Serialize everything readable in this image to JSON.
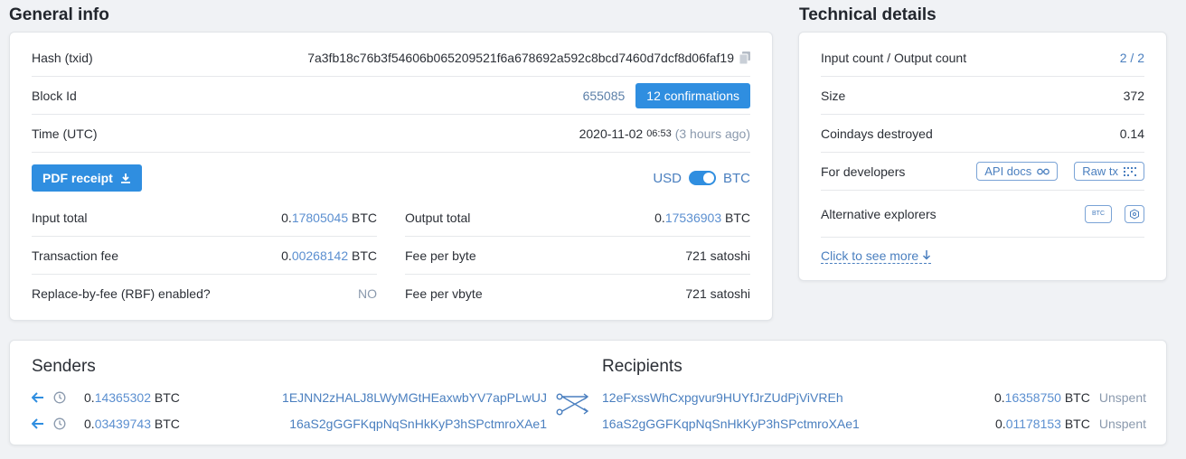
{
  "general": {
    "title": "General info",
    "hash_label": "Hash (txid)",
    "hash_value": "7a3fb18c76b3f54606b065209521f6a678692a592c8bcd7460d7dcf8d06faf19",
    "block_label": "Block Id",
    "block_value": "655085",
    "confirmations": "12 confirmations",
    "time_label": "Time (UTC)",
    "time_date": "2020-11-02",
    "time_clock": "06:53",
    "time_ago": "(3 hours ago)",
    "pdf_label": "PDF receipt",
    "toggle_left": "USD",
    "toggle_right": "BTC",
    "input_total_label": "Input total",
    "input_total_int": "0.",
    "input_total_frac": "17805045",
    "output_total_label": "Output total",
    "output_total_int": "0.",
    "output_total_frac": "17536903",
    "fee_label": "Transaction fee",
    "fee_int": "0.",
    "fee_frac": "00268142",
    "fee_byte_label": "Fee per byte",
    "fee_byte_value": "721 satoshi",
    "rbf_label": "Replace-by-fee (RBF) enabled?",
    "rbf_value": "NO",
    "fee_vbyte_label": "Fee per vbyte",
    "fee_vbyte_value": "721 satoshi",
    "unit": "BTC"
  },
  "technical": {
    "title": "Technical details",
    "io_label": "Input count / Output count",
    "io_value": "2 / 2",
    "size_label": "Size",
    "size_value": "372",
    "coindays_label": "Coindays destroyed",
    "coindays_value": "0.14",
    "dev_label": "For developers",
    "api_docs": "API docs",
    "raw_tx": "Raw tx",
    "alt_label": "Alternative explorers",
    "alt_badge": "BTC",
    "more": "Click to see more"
  },
  "flow": {
    "senders_title": "Senders",
    "recipients_title": "Recipients",
    "senders": [
      {
        "int": "0.",
        "frac": "14365302",
        "unit": "BTC",
        "address": "1EJNN2zHALJ8LWyMGtHEaxwbYV7apPLwUJ"
      },
      {
        "int": "0.",
        "frac": "03439743",
        "unit": "BTC",
        "address": "16aS2gGGFKqpNqSnHkKyP3hSPctmroXAe1"
      }
    ],
    "recipients": [
      {
        "address": "12eFxssWhCxpgvur9HUYfJrZUdPjViVREh",
        "int": "0.",
        "frac": "16358750",
        "unit": "BTC",
        "status": "Unspent"
      },
      {
        "address": "16aS2gGGFKqpNqSnHkKyP3hSPctmroXAe1",
        "int": "0.",
        "frac": "01178153",
        "unit": "BTC",
        "status": "Unspent"
      }
    ]
  },
  "colors": {
    "accent": "#2f8ee0",
    "link": "#4a7fbf",
    "muted": "#8a99ad"
  }
}
